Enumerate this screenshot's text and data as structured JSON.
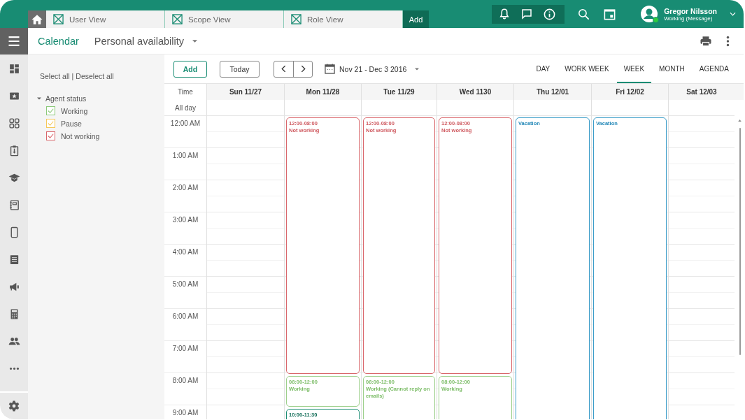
{
  "top_bar": {
    "tabs": [
      {
        "label": "User View",
        "selected": false
      },
      {
        "label": "Scope View",
        "selected": false
      },
      {
        "label": "Role View",
        "selected": false
      }
    ],
    "add_tab": "Add",
    "user": {
      "name": "Gregor Nilsson",
      "status": "Working (Message)"
    }
  },
  "header": {
    "title": "Calendar",
    "view_select": "Personal availability"
  },
  "filters": {
    "select_all": "Select all",
    "separator": "|",
    "deselect_all": "Deselect all",
    "groups": [
      {
        "label": "Agent status",
        "expanded": true,
        "children": [
          {
            "label": "Working",
            "checked": true,
            "color": "#8cc97a"
          },
          {
            "label": "Pause",
            "checked": true,
            "color": "#f5c85a"
          },
          {
            "label": "Not working",
            "checked": true,
            "color": "#d9666b"
          }
        ]
      }
    ]
  },
  "toolbar": {
    "add": "Add",
    "today": "Today",
    "date_range": "Nov 21 - Dec 3 2016",
    "views": [
      {
        "label": "DAY",
        "selected": false
      },
      {
        "label": "WORK WEEK",
        "selected": false
      },
      {
        "label": "WEEK",
        "selected": true
      },
      {
        "label": "MONTH",
        "selected": false
      },
      {
        "label": "AGENDA",
        "selected": false
      }
    ]
  },
  "calendar": {
    "time_header": "Time",
    "all_day": "All day",
    "hours": [
      "12:00 AM",
      "1:00 AM",
      "2:00 AM",
      "3:00 AM",
      "4:00 AM",
      "5:00 AM",
      "6:00 AM",
      "7:00 AM",
      "8:00 AM",
      "9:00 AM"
    ],
    "days": [
      {
        "label": "Sun 11/27"
      },
      {
        "label": "Mon 11/28",
        "events": [
          {
            "kind": "not_working",
            "time": "12:00-08:00",
            "title": "Not working"
          },
          {
            "kind": "working",
            "time": "08:00-12:00",
            "title": "Working"
          },
          {
            "kind": "appointment",
            "time": "10:00-11:30"
          }
        ]
      },
      {
        "label": "Tue 11/29",
        "events": [
          {
            "kind": "not_working",
            "time": "12:00-08:00",
            "title": "Not working"
          },
          {
            "kind": "working",
            "time": "08:00-12:00",
            "title": "Working (Cannot reply on emails)"
          }
        ]
      },
      {
        "label": "Wed 1130",
        "events": [
          {
            "kind": "not_working",
            "time": "12:00-08:00",
            "title": "Not working"
          },
          {
            "kind": "working",
            "time": "08:00-12:00",
            "title": "Working"
          }
        ]
      },
      {
        "label": "Thu 12/01",
        "events": [
          {
            "kind": "vacation",
            "title": "Vacation"
          }
        ]
      },
      {
        "label": "Fri 12/02",
        "events": [
          {
            "kind": "vacation",
            "title": "Vacation"
          }
        ]
      },
      {
        "label": "Sat 12/03"
      }
    ]
  }
}
